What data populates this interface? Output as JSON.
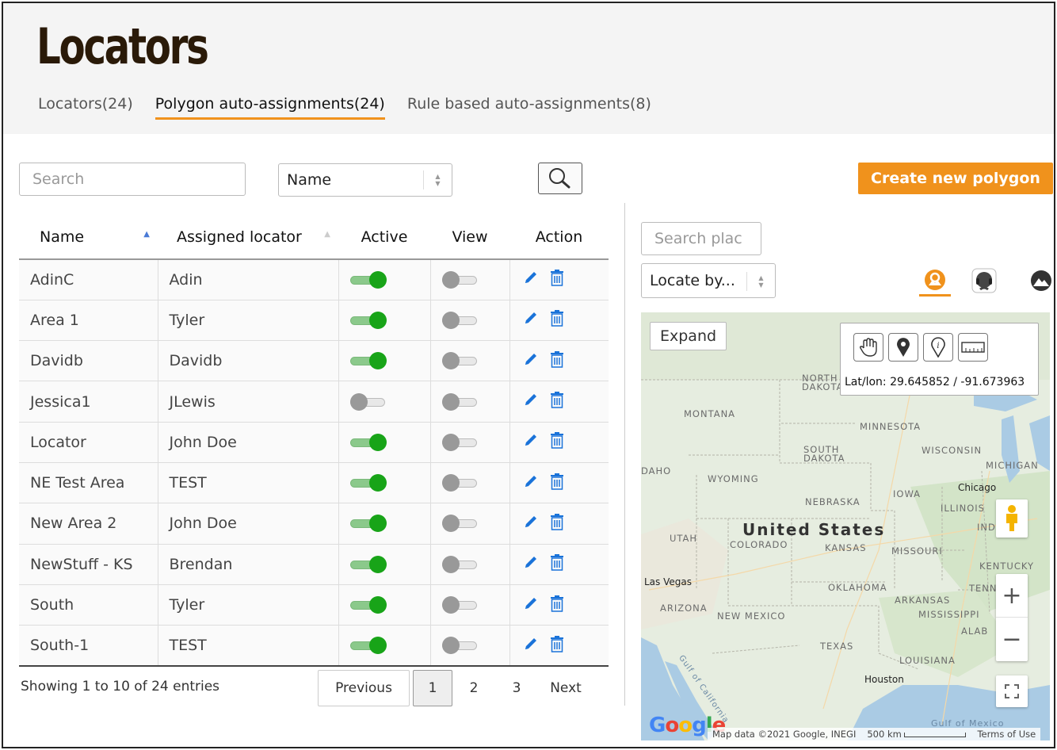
{
  "page": {
    "title": "Locators",
    "tabs": [
      {
        "label": "Locators(24)",
        "active": false
      },
      {
        "label": "Polygon auto-assignments(24)",
        "active": true
      },
      {
        "label": "Rule based auto-assignments(8)",
        "active": false
      }
    ]
  },
  "toolbar": {
    "search_placeholder": "Search",
    "field_select": "Name",
    "create_button": "Create new polygon"
  },
  "table": {
    "columns": [
      "Name",
      "Assigned locator",
      "Active",
      "View",
      "Action"
    ],
    "rows": [
      {
        "name": "AdinC",
        "locator": "Adin",
        "active": true,
        "view": false
      },
      {
        "name": "Area 1",
        "locator": "Tyler",
        "active": true,
        "view": false
      },
      {
        "name": "Davidb",
        "locator": "Davidb",
        "active": true,
        "view": false
      },
      {
        "name": "Jessica1",
        "locator": "JLewis",
        "active": false,
        "view": false
      },
      {
        "name": "Locator",
        "locator": "John Doe",
        "active": true,
        "view": false
      },
      {
        "name": "NE Test Area",
        "locator": "TEST",
        "active": true,
        "view": false
      },
      {
        "name": "New Area 2",
        "locator": "John Doe",
        "active": true,
        "view": false
      },
      {
        "name": "NewStuff - KS",
        "locator": "Brendan",
        "active": true,
        "view": false
      },
      {
        "name": "South",
        "locator": "Tyler",
        "active": true,
        "view": false
      },
      {
        "name": "South-1",
        "locator": "TEST",
        "active": true,
        "view": false
      }
    ],
    "entries_info": "Showing 1 to 10 of 24 entries"
  },
  "pagination": {
    "previous": "Previous",
    "pages": [
      "1",
      "2",
      "3"
    ],
    "current": "1",
    "next": "Next"
  },
  "map_panel": {
    "place_search_placeholder": "Search plac",
    "locate_select": "Locate by...",
    "mode_icons": [
      "locator-area-icon",
      "headset-icon",
      "terrain-icon"
    ],
    "expand_button": "Expand",
    "tools": [
      "pan-hand-icon",
      "map-pin-icon",
      "info-pin-icon",
      "ruler-icon"
    ],
    "latlon_text": "Lat/lon: 29.645852 / -91.673963",
    "labels": {
      "country": "United States",
      "states": [
        "MONTANA",
        "NORTH DAKOTA",
        "MINNESOTA",
        "SOUTH DAKOTA",
        "WISCONSIN",
        "MICHIGAN",
        "WYOMING",
        "IOWA",
        "NEBRASKA",
        "ILLINOIS",
        "IND",
        "UTAH",
        "COLORADO",
        "KANSAS",
        "MISSOURI",
        "KENTUCKY",
        "OKLAHOMA",
        "ARKANSAS",
        "TENNE",
        "ARIZONA",
        "NEW MEXICO",
        "MISSISSIPPI",
        "ALAB",
        "TEXAS",
        "LOUISIANA",
        "DAHO"
      ],
      "cities": [
        "Chicago",
        "Las Vegas",
        "Houston"
      ],
      "water": [
        "Gulf of California",
        "Gulf of Mexico"
      ]
    },
    "google_logo": "Google",
    "attribution": "Map data ©2021 Google, INEGI",
    "scale": "500 km",
    "terms": "Terms of Use"
  },
  "colors": {
    "accent": "#f0921c",
    "toggle_on": "#18a418",
    "icon_blue": "#1a73d9"
  }
}
